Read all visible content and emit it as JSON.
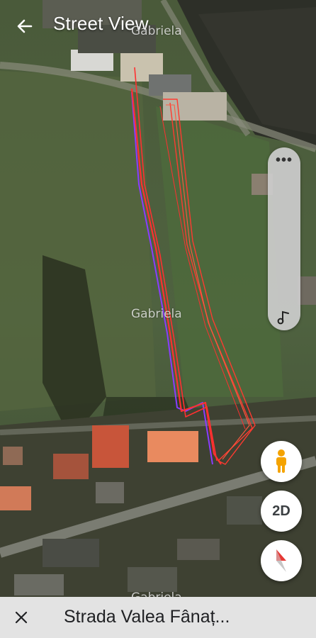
{
  "header": {
    "title": "Street View"
  },
  "watermarks": [
    "Gabriela",
    "Gabriela",
    "Gabriela"
  ],
  "controls": {
    "slider_menu": "•••",
    "pegman": "pegman-icon",
    "mode_toggle": "2D",
    "compass": "compass-icon"
  },
  "footer": {
    "place_name": "Strada Valea Fânaț..."
  },
  "colors": {
    "trace_red": "#ff3030",
    "trace_purple": "#8a3cff",
    "control_bg": "#ffffff",
    "pegman": "#f4a300",
    "compass_red": "#e53935"
  }
}
